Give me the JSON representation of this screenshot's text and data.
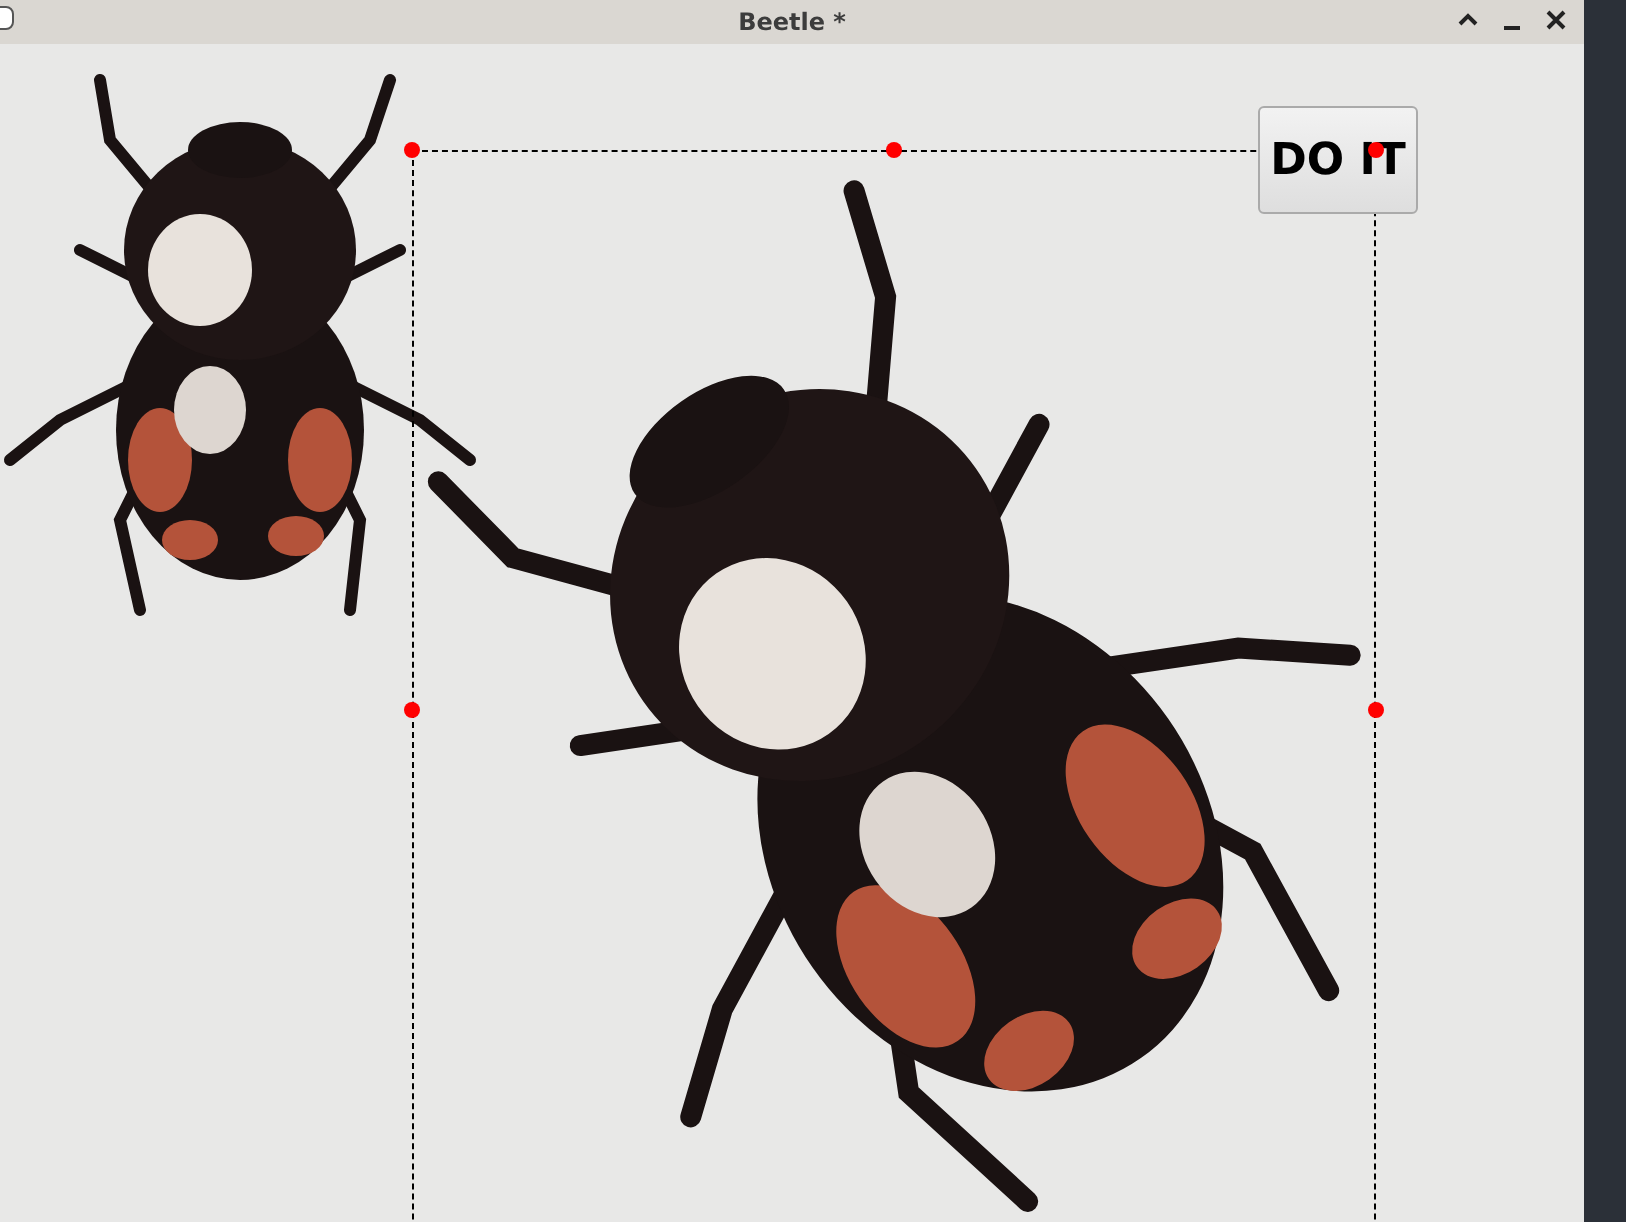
{
  "window": {
    "title": "Beetle *"
  },
  "canvas": {
    "button": {
      "label": "DO IT"
    }
  }
}
